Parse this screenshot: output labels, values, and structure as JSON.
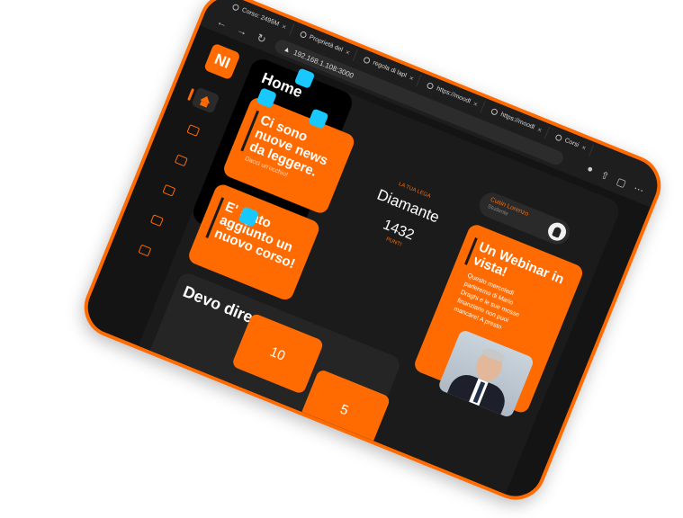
{
  "browser": {
    "tabs": [
      {
        "title": "Corso: 2495M"
      },
      {
        "title": "Proprietà del"
      },
      {
        "title": "regola di lapl"
      },
      {
        "title": "https://moodl"
      },
      {
        "title": "https://moodl"
      },
      {
        "title": "Corsi"
      }
    ],
    "url": "192.168.1.108:3000",
    "back_icon": "arrow-left-icon",
    "forward_icon": "arrow-right-icon",
    "reload_icon": "reload-icon"
  },
  "app": {
    "logo": "NI",
    "page_title": "Home",
    "sidebar": [
      {
        "icon": "home-icon"
      },
      {
        "icon": "calendar-icon"
      },
      {
        "icon": "document-icon"
      },
      {
        "icon": "video-icon"
      },
      {
        "icon": "camera-icon"
      },
      {
        "icon": "book-icon"
      }
    ],
    "news_card": {
      "title": "Ci sono nuove news da leggere.",
      "subtitle": "Dacci un'occhio!"
    },
    "course_card": {
      "title": "E' stato aggiunto un nuovo corso!"
    },
    "league": {
      "label": "LA TUA LEGA",
      "name": "Diamante",
      "points": "1432",
      "points_label": "PUNTI"
    },
    "user": {
      "name": "Cusin Lorenzo",
      "role": "Studente"
    },
    "webinar": {
      "title": "Un Webinar in vista!",
      "body": "Questo mercoledì parleremo di Mario Draghi e le sue mosse finanziarie non puoi mancare! A presto"
    },
    "discussion": {
      "title": "Devo dire"
    },
    "stats": [
      "10",
      "5"
    ]
  },
  "colors": {
    "accent": "#ff6b00",
    "background": "#141414",
    "gem": "#18c8ff"
  }
}
